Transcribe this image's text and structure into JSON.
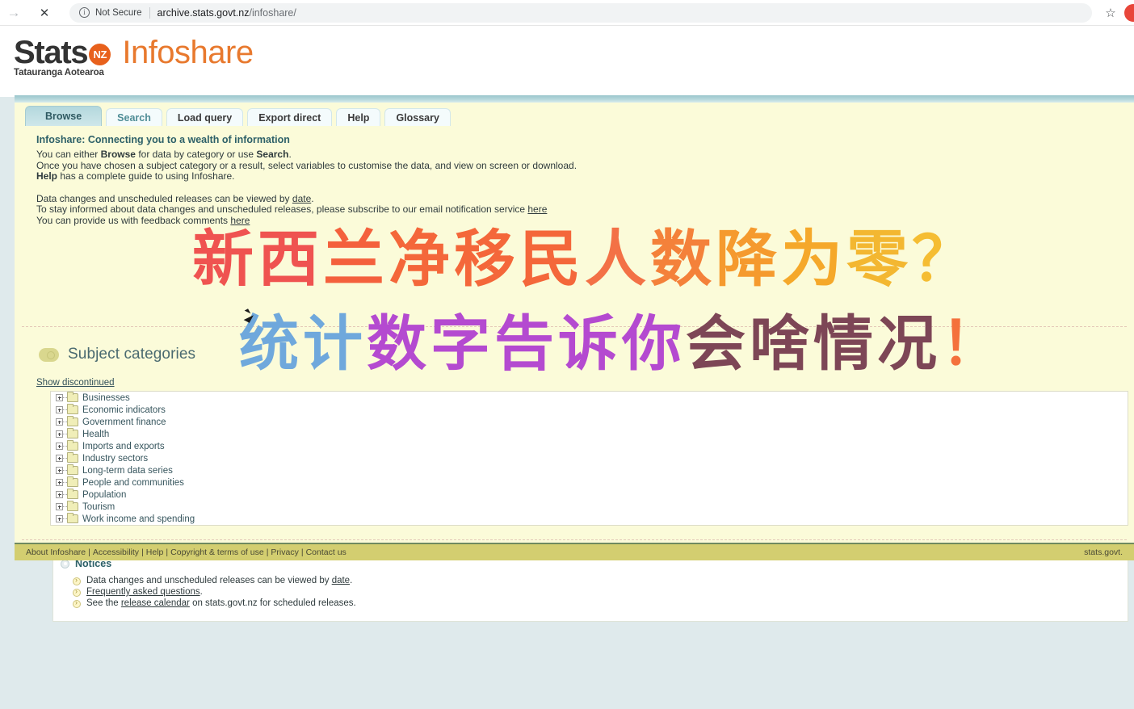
{
  "browser": {
    "forward_icon": "arrow-right-icon",
    "stop_icon": "close-icon",
    "security_info_icon": "info-circle-icon",
    "security_label": "Not Secure",
    "url_domain": "archive.stats.govt.nz",
    "url_path": "/infoshare/",
    "star_icon": "star-icon",
    "profile_icon": "profile-avatar"
  },
  "logo": {
    "stats": "Stats",
    "badge": "NZ",
    "infoshare": "Infoshare",
    "tagline": "Tatauranga Aotearoa"
  },
  "tabs": [
    {
      "label": "Browse",
      "active": true
    },
    {
      "label": "Search",
      "active": false
    },
    {
      "label": "Load query",
      "active": false
    },
    {
      "label": "Export direct",
      "active": false
    },
    {
      "label": "Help",
      "active": false
    },
    {
      "label": "Glossary",
      "active": false
    }
  ],
  "intro": {
    "heading": "Infoshare: Connecting you to a wealth of information",
    "line1_a": "You can either ",
    "line1_b": "Browse",
    "line1_c": " for data by category or use ",
    "line1_d": "Search",
    "line1_e": ".",
    "line2": "Once you have chosen a subject category or a result, select variables to customise the data, and view on screen or download.",
    "line3_a": "Help",
    "line3_b": " has a complete guide to using Infoshare.",
    "line4_a": "Data changes and unscheduled releases can be viewed by ",
    "line4_link": "date",
    "line4_b": ".",
    "line5_a": "To stay informed about data changes and unscheduled releases, please subscribe to our email notification service ",
    "line5_link": "here",
    "line6_a": "You can provide us with feedback comments ",
    "line6_link": "here"
  },
  "subject": {
    "icon": "category-pill-icon",
    "title": "Subject categories",
    "show_discontinued": "Show discontinued",
    "categories": [
      "Businesses",
      "Economic indicators",
      "Government finance",
      "Health",
      "Imports and exports",
      "Industry sectors",
      "Long-term data series",
      "People and communities",
      "Population",
      "Tourism",
      "Work income and spending"
    ]
  },
  "notices": {
    "title": "Notices",
    "items": [
      {
        "pre": "Data changes and unscheduled releases can be viewed by ",
        "link": "date",
        "post": "."
      },
      {
        "pre": "",
        "link": "Frequently asked questions",
        "post": "."
      },
      {
        "pre": "See the ",
        "link": "release calendar",
        "post": " on stats.govt.nz for scheduled releases."
      }
    ]
  },
  "footer": {
    "links": [
      "About Infoshare",
      "Accessibility",
      "Help",
      "Copyright & terms of use",
      "Privacy",
      "Contact us"
    ],
    "right": "stats.govt."
  },
  "overlay": {
    "line1": "新西兰净移民人数降为零？",
    "line2": "统计数字告诉你会啥情况！",
    "line1_colors": [
      "#ef5350",
      "#ef5350",
      "#f4603c",
      "#f4673a",
      "#f4673a",
      "#f4673a",
      "#f37146",
      "#f4813a",
      "#f59a2e",
      "#f5a82a",
      "#f3b731",
      "#f5bd33"
    ],
    "line2_colors": [
      "#6fa8dc",
      "#6fa8dc",
      "#b44ad0",
      "#b44ad0",
      "#b44ad0",
      "#b44ad0",
      "#b44ad0",
      "#7d4656",
      "#7d4656",
      "#7d4656",
      "#7d4656",
      "#f4713c"
    ]
  },
  "colors": {
    "page_bg": "#fbfbd9",
    "accent_orange": "#e8792e",
    "teal": "#4f8d96",
    "footer": "#d3ce70"
  }
}
